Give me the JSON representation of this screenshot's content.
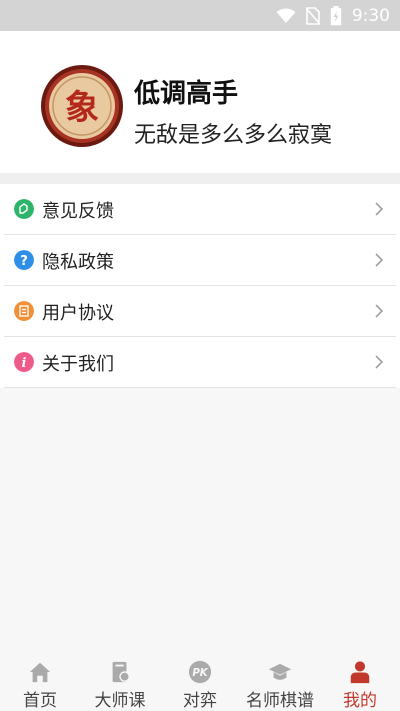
{
  "status_bar": {
    "time": "9:30"
  },
  "profile": {
    "avatar_glyph": "象",
    "name": "低调高手",
    "motto": "无敌是多么多么寂寞"
  },
  "menu": {
    "items": [
      {
        "label": "意见反馈",
        "icon": "feedback-icon",
        "color": "#2db36a"
      },
      {
        "label": "隐私政策",
        "icon": "question-icon",
        "color": "#2f8fe6"
      },
      {
        "label": "用户协议",
        "icon": "document-icon",
        "color": "#f0913a"
      },
      {
        "label": "关于我们",
        "icon": "info-icon",
        "color": "#ee5a8a"
      }
    ]
  },
  "tabbar": {
    "active_color": "#c0392b",
    "tabs": [
      {
        "label": "首页",
        "icon": "home-icon"
      },
      {
        "label": "大师课",
        "icon": "course-icon"
      },
      {
        "label": "对弈",
        "icon": "pk-icon"
      },
      {
        "label": "名师棋谱",
        "icon": "graduation-cap-icon"
      },
      {
        "label": "我的",
        "icon": "person-icon",
        "active": true
      }
    ]
  }
}
